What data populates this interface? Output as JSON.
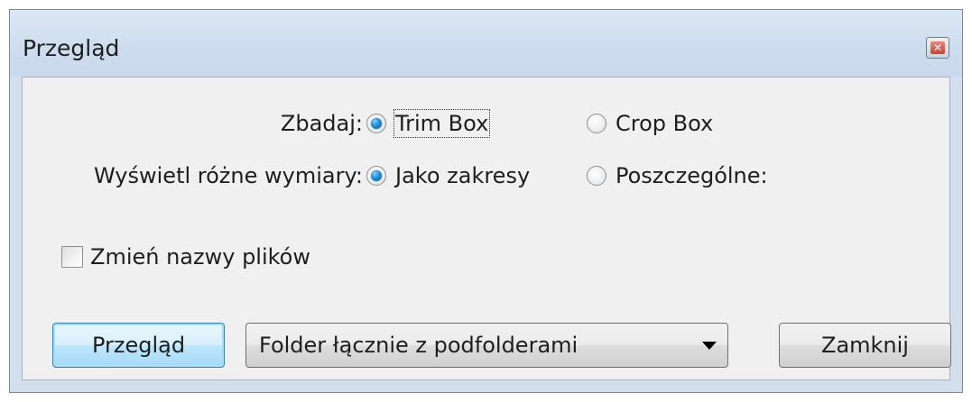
{
  "window": {
    "title": "Przegląd",
    "close_icon": "close-icon"
  },
  "inspect": {
    "label": "Zbadaj:",
    "options": [
      {
        "label": "Trim Box",
        "selected": true
      },
      {
        "label": "Crop Box",
        "selected": false
      }
    ]
  },
  "display_sizes": {
    "label": "Wyświetl różne wymiary:",
    "options": [
      {
        "label": "Jako zakresy",
        "selected": true
      },
      {
        "label": "Poszczególne:",
        "selected": false
      }
    ]
  },
  "rename_files": {
    "label": "Zmień nazwy plików",
    "checked": false
  },
  "buttons": {
    "browse": "Przegląd",
    "close": "Zamknij"
  },
  "scope_select": {
    "value": "Folder łącznie z podfolderami"
  },
  "colors": {
    "accent": "#1f8fd6",
    "title_bar": "#cddcee",
    "client_bg": "#f0f0f0"
  }
}
